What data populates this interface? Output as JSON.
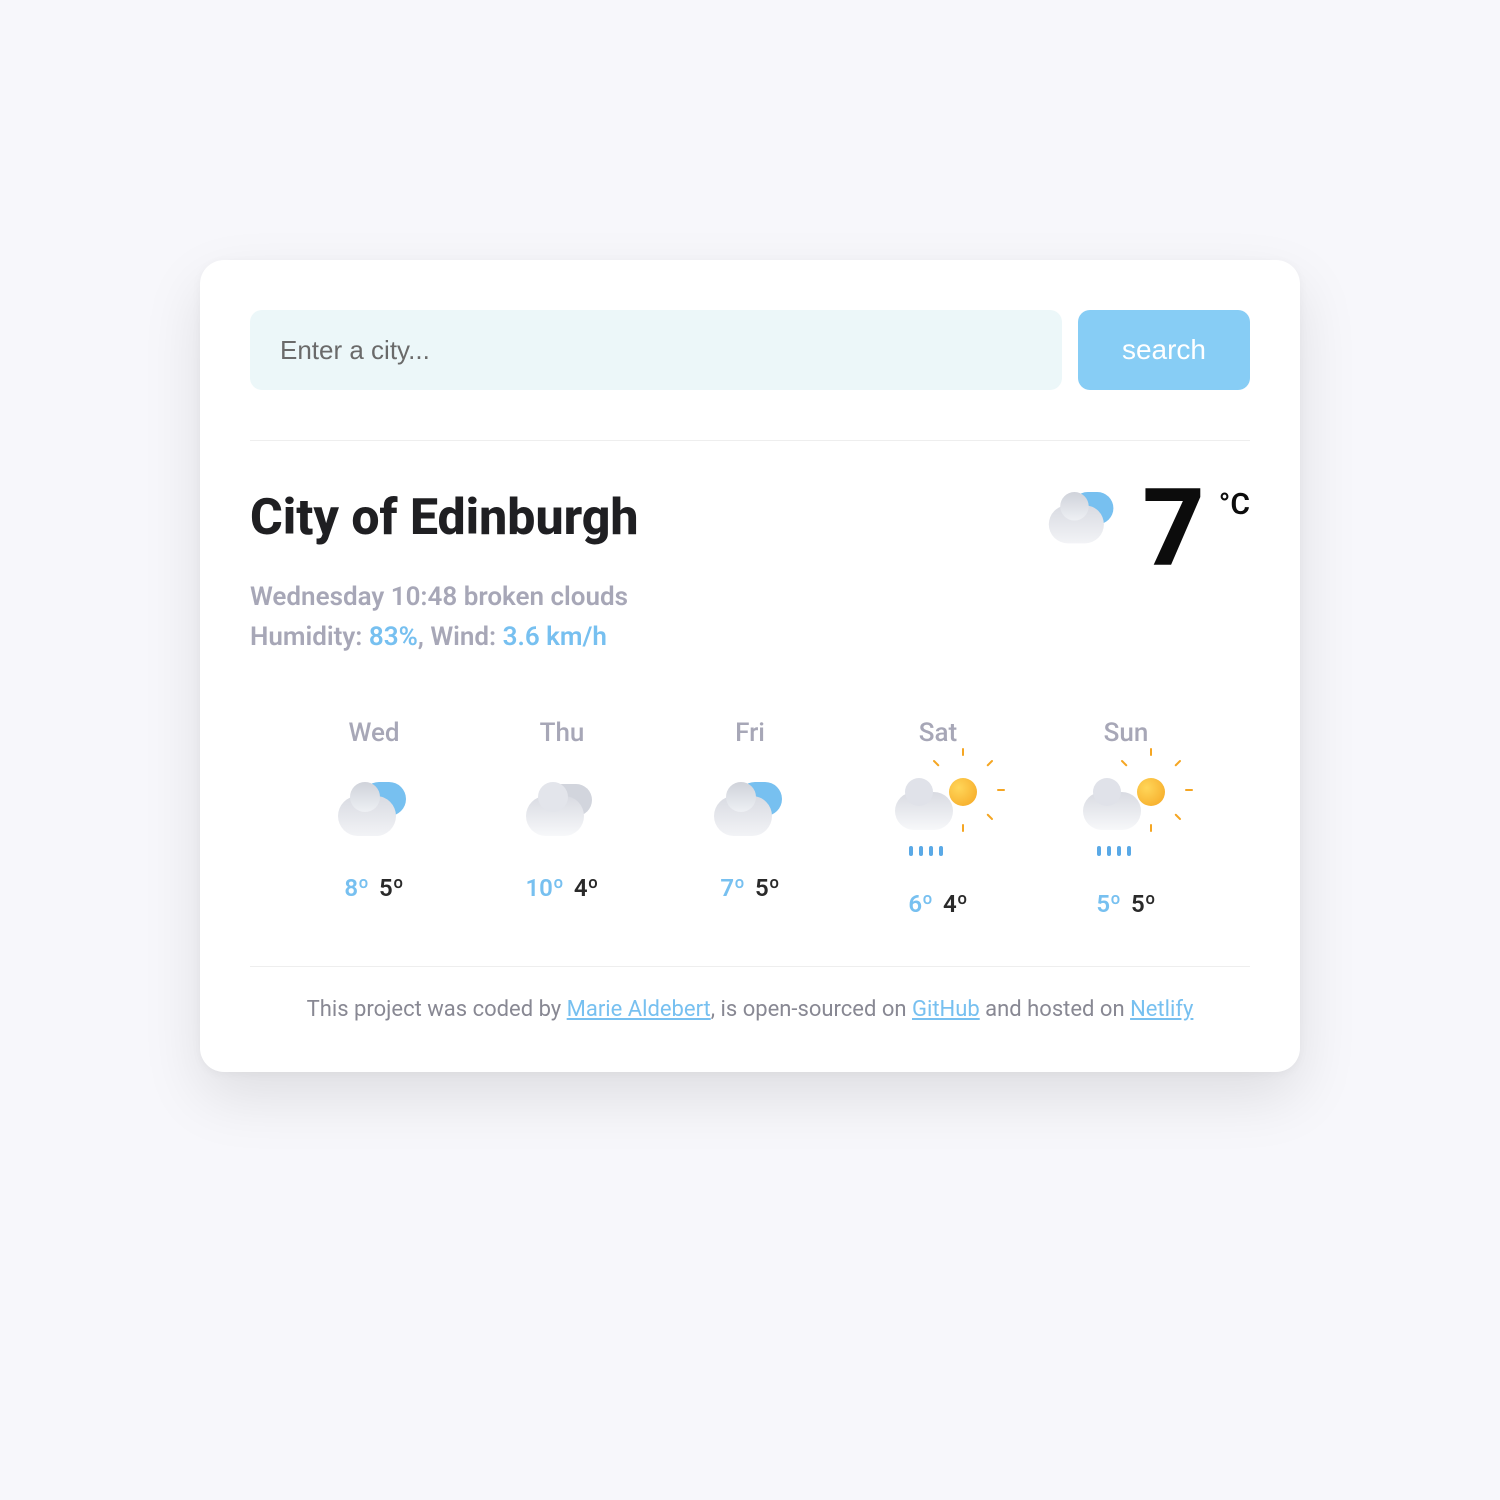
{
  "search": {
    "placeholder": "Enter a city...",
    "button": "search"
  },
  "current": {
    "city": "City of Edinburgh",
    "datetime": "Wednesday 10:48",
    "description": "broken clouds",
    "humidity_label": "Humidity:",
    "humidity_value": "83%",
    "wind_label": ", Wind:",
    "wind_value": "3.6 km/h",
    "temp": "7",
    "unit": "°C",
    "icon": "broken-clouds"
  },
  "forecast": [
    {
      "day": "Wed",
      "icon": "broken-clouds",
      "hi": "8º",
      "lo": "5º"
    },
    {
      "day": "Thu",
      "icon": "overcast",
      "hi": "10º",
      "lo": "4º"
    },
    {
      "day": "Fri",
      "icon": "broken-clouds",
      "hi": "7º",
      "lo": "5º"
    },
    {
      "day": "Sat",
      "icon": "sun-rain",
      "hi": "6º",
      "lo": "4º"
    },
    {
      "day": "Sun",
      "icon": "sun-rain",
      "hi": "5º",
      "lo": "5º"
    }
  ],
  "footer": {
    "pre": "This project was coded by ",
    "author": "Marie Aldebert",
    "mid1": ", is open-sourced on ",
    "link1": "GitHub",
    "mid2": " and hosted on ",
    "link2": "Netlify"
  }
}
